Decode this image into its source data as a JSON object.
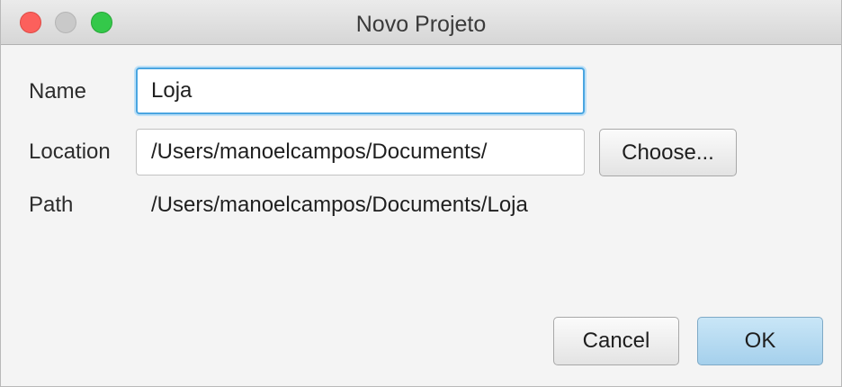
{
  "window": {
    "title": "Novo Projeto"
  },
  "form": {
    "name_label": "Name",
    "name_value": "Loja",
    "location_label": "Location",
    "location_value": "/Users/manoelcampos/Documents/",
    "choose_label": "Choose...",
    "path_label": "Path",
    "path_value": "/Users/manoelcampos/Documents/Loja"
  },
  "actions": {
    "cancel_label": "Cancel",
    "ok_label": "OK"
  },
  "colors": {
    "close": "#fc605c",
    "minimize": "#c9c9c9",
    "zoom": "#34c84a",
    "focus_ring": "#4aa5e0",
    "default_button": "#a5d0ec"
  }
}
